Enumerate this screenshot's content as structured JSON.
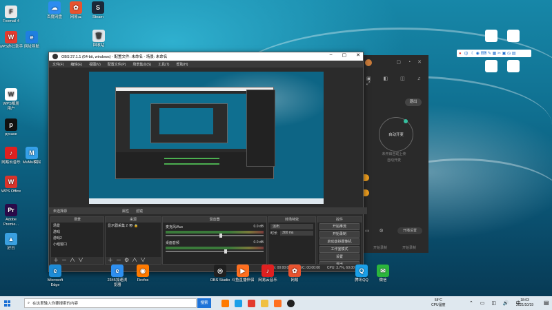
{
  "desktop": {
    "icons_left": [
      {
        "label": "Foxmail 4",
        "color": "#e9e9e9",
        "glyph": "F"
      },
      {
        "label": "WPS办公助手",
        "color": "#e33b2e",
        "glyph": "W"
      },
      {
        "label": "WPS相册\n用户",
        "color": "#ffffff",
        "glyph": "W"
      },
      {
        "label": "pycase",
        "color": "#111111",
        "glyph": "p"
      },
      {
        "label": "网易云音乐",
        "color": "#e02020",
        "glyph": "♪"
      },
      {
        "label": "WPS Office",
        "color": "#d9342b",
        "glyph": "W"
      },
      {
        "label": "Adobe\nPremie...",
        "color": "#2a0a4a",
        "glyph": "Pr"
      },
      {
        "label": "好日",
        "color": "#3aa0e0",
        "glyph": "▲"
      }
    ],
    "icons_col2": [
      {
        "label": "网址导航",
        "color": "#1f7fe0",
        "glyph": "e"
      },
      {
        "label": "MuMu模拟",
        "color": "#35a0e8",
        "glyph": "M"
      }
    ],
    "icons_top": [
      {
        "label": "百度网盘",
        "color": "#2d8cf0",
        "glyph": "☁"
      },
      {
        "label": "网易云",
        "color": "#e8532f",
        "glyph": "✿"
      },
      {
        "label": "Steam",
        "color": "#1b2838",
        "glyph": "S"
      },
      {
        "label": "回收站",
        "color": "#dfe6ea",
        "glyph": "🗑"
      }
    ],
    "icons_right": [
      {
        "label": "",
        "color": "#ffffff",
        "glyph": ""
      },
      {
        "label": "",
        "color": "#ffffff",
        "glyph": ""
      },
      {
        "label": "",
        "color": "#ffffff",
        "glyph": ""
      },
      {
        "label": "",
        "color": "#ffffff",
        "glyph": ""
      }
    ],
    "icons_bottom": [
      {
        "label": "Microsoft\nEdge",
        "color": "#1d8bd6",
        "glyph": "e"
      },
      {
        "label": "2345加速浏\n览器",
        "color": "#2e8ff0",
        "glyph": "e"
      },
      {
        "label": "Firefox",
        "color": "#ff7a00",
        "glyph": "◉"
      },
      {
        "label": "OBS Studio",
        "color": "#202020",
        "glyph": "◎"
      },
      {
        "label": "斗鱼直播伴侣",
        "color": "#ff6f1f",
        "glyph": "▶"
      },
      {
        "label": "网易云音乐",
        "color": "#e02020",
        "glyph": "♪"
      },
      {
        "label": "网易",
        "color": "#e8532f",
        "glyph": "✿"
      },
      {
        "label": "腾讯QQ",
        "color": "#1aa0e8",
        "glyph": "Q"
      },
      {
        "label": "微信",
        "color": "#2bb63c",
        "glyph": "✉"
      }
    ]
  },
  "obs": {
    "title": "OBS 27.1.1 (64-bit, windows) - 配置文件: 未命名 - 场景: 未命名",
    "menu": [
      "文件(F)",
      "编辑(E)",
      "视图(V)",
      "配置文件(P)",
      "场景集合(S)",
      "工具(T)",
      "帮助(H)"
    ],
    "source_bar": {
      "label": "未选择源",
      "props": "属性",
      "filters": "滤镜"
    },
    "scenes": {
      "header": "场景",
      "items": [
        "场景",
        "游戏",
        "游戏2",
        "小组窗口"
      ]
    },
    "sources": {
      "header": "来源",
      "items": [
        "显示器采集 2"
      ]
    },
    "mixer": {
      "header": "混音器",
      "tracks": [
        {
          "name": "麦克风/Aux",
          "db": "0.0 dB",
          "level": 0.55
        },
        {
          "name": "桌面音频",
          "db": "0.0 dB",
          "level": 0.6
        }
      ]
    },
    "transition": {
      "header": "转场特效",
      "type": "淡出",
      "duration_label": "时长",
      "duration": "300 ms"
    },
    "controls": {
      "header": "控件",
      "buttons": [
        "开始推流",
        "开始录制",
        "启动虚拟摄像机",
        "工作室模式",
        "设置",
        "退出"
      ]
    },
    "status": {
      "live": "LIVE: 00:00:00",
      "rec": "REC: 00:00:00",
      "cpu": "CPU: 3.7%, 60.00 fps"
    }
  },
  "side_panel": {
    "exit": "退出",
    "center": "自动开麦",
    "text1": "未开启自动上传",
    "text2": "自动开麦",
    "bottom_btn": "开播设置",
    "footer_left": "开始录制",
    "footer_right": "开始录制"
  },
  "ime": {
    "label": "中"
  },
  "taskbar": {
    "search_placeholder": "在这里输入你要搜索的内容",
    "search_button": "搜索",
    "weather_temp": "58°C",
    "weather_text": "CPU温度",
    "time": "18:03",
    "date": "2021/10/19"
  }
}
